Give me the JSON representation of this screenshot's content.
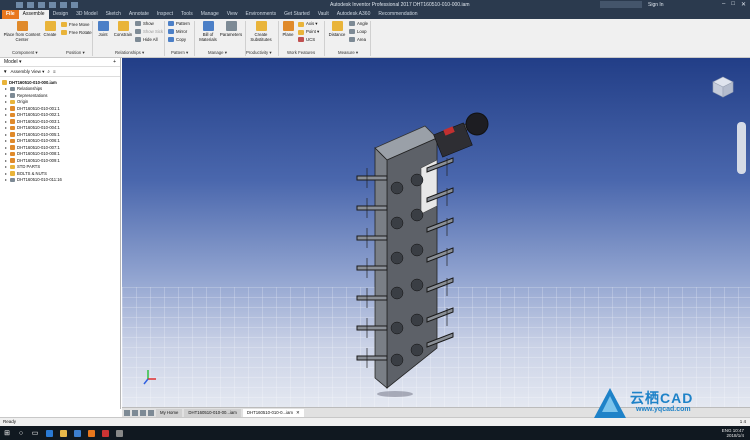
{
  "titlebar": {
    "title": "Autodesk Inventor Professional 2017   DHT160510-010-000.iam",
    "signin": "Sign In"
  },
  "tabs": [
    "File",
    "Assemble",
    "Design",
    "3D Model",
    "Sketch",
    "Annotate",
    "Inspect",
    "Tools",
    "Manage",
    "View",
    "Environments",
    "Get Started",
    "Vault",
    "Autodesk A360",
    "Recommendation"
  ],
  "ribbon": {
    "component": {
      "place_from_cc": "Place from Content Center",
      "create": "Create",
      "free_move": "Free Move",
      "free_rotate": "Free Rotate",
      "label": "Component ▾",
      "position_label": "Position ▾"
    },
    "relationships": {
      "joint": "Joint",
      "constrain": "Constrain",
      "show": "Show",
      "show_sick": "Show Sick",
      "hide_all": "Hide All",
      "label": "Relationships ▾"
    },
    "pattern": {
      "pattern": "Pattern",
      "mirror": "Mirror",
      "copy": "Copy",
      "label": "Pattern ▾"
    },
    "manage": {
      "bom": "Bill of Materials",
      "parameters": "Parameters",
      "label": "Manage ▾"
    },
    "productivity": {
      "create_substitutes": "Create Substitutes",
      "label": "Productivity ▾"
    },
    "work_features": {
      "plane": "Plane",
      "axis": "Axis ▾",
      "point": "Point ▾",
      "ucs": "UCS",
      "label": "Work Features"
    },
    "measure": {
      "distance": "Distance",
      "angle": "Angle",
      "loop": "Loop",
      "area": "Area",
      "label": "Measure ▾"
    }
  },
  "browser": {
    "header": "Model ▾",
    "view_label": "Assembly View ▾",
    "root": "DHT160510-010-000.iam",
    "items": [
      "Relationships",
      "Representations",
      "Origin",
      "DHT160510-010-001:1",
      "DHT160510-010-002:1",
      "DHT160510-010-003:1",
      "DHT160510-010-004:1",
      "DHT160510-010-005:1",
      "DHT160510-010-006:1",
      "DHT160510-010-007:1",
      "DHT160510-010-008:1",
      "DHT160510-010-009:1",
      "STD PARTS",
      "BOLTS & NUTS",
      "DHT160510-010-011:16"
    ]
  },
  "doc_tabs": {
    "home": "My Home",
    "tab1": "DHT160510-010-00...iam",
    "tab2": "DHT160510-010-0...iam"
  },
  "status": {
    "left": "Ready",
    "right": "1  4"
  },
  "taskbar": {
    "time": "10:47",
    "date": "2018/1/4",
    "lang": "ENG"
  },
  "watermark": {
    "name": "云栖CAD",
    "url": "www.yqcad.com"
  },
  "colors": {
    "file_tab": "#e8771d",
    "title_bg": "#2b3a4e",
    "viewport_top": "#223e87",
    "viewport_bottom": "#e4e8f1"
  }
}
